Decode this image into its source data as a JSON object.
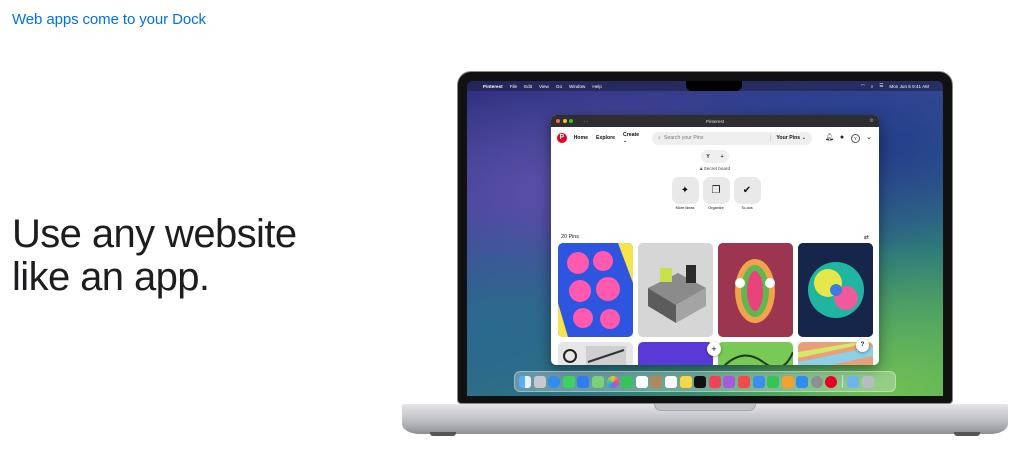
{
  "page": {
    "eyebrow": "Web apps come to your Dock",
    "headline_line1": "Use any website",
    "headline_line2": "like an app."
  },
  "menubar": {
    "apple": "",
    "app": "Pinterest",
    "items": [
      "File",
      "Edit",
      "View",
      "Go",
      "Window",
      "Help"
    ],
    "clock": "Mon Jun 5  9:41 AM"
  },
  "window": {
    "title": "Pinterest",
    "toolbar": {
      "logo": "P",
      "home": "Home",
      "explore": "Explore",
      "create": "Create",
      "search_placeholder": "Search your Pins",
      "scope": "Your Pins",
      "avatar": "Y"
    },
    "board": {
      "collaborator": "Y",
      "add": "+",
      "secret_label": "Secret board",
      "actions": [
        {
          "label": "More ideas",
          "icon": "sparkle-icon"
        },
        {
          "label": "Organize",
          "icon": "organize-icon"
        },
        {
          "label": "To-dos",
          "icon": "check-icon"
        }
      ]
    },
    "pins": {
      "count_label": "20 Pins",
      "fab": "+",
      "help": "?"
    }
  },
  "dock": {
    "apps": [
      "finder",
      "launchpad",
      "safari",
      "messages",
      "mail",
      "maps",
      "photos",
      "facetime",
      "calendar",
      "contacts",
      "reminders",
      "notes",
      "tv",
      "music",
      "podcasts",
      "news",
      "keynote",
      "numbers",
      "pages",
      "app-store",
      "settings",
      "pinterest",
      "downloads",
      "trash"
    ]
  },
  "colors": {
    "accent": "#0071e3",
    "pinterest_red": "#e60023"
  }
}
